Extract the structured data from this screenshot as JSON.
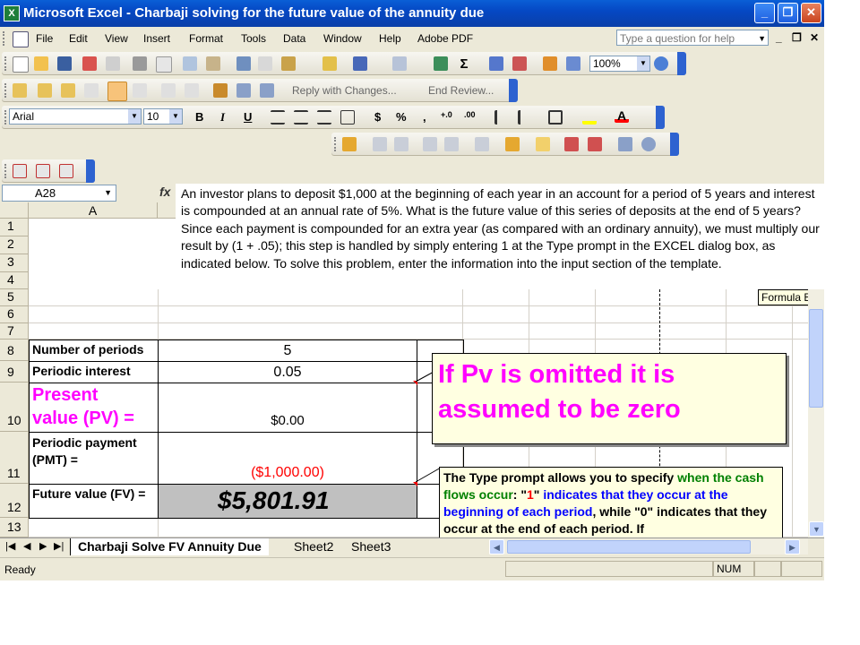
{
  "window": {
    "title": "Microsoft Excel - Charbaji solving  for the future value of the annuity due",
    "app_icon_glyph": "X",
    "minimize_glyph": "_",
    "restore_glyph": "❐",
    "close_glyph": "✕"
  },
  "menu": {
    "items": [
      "File",
      "Edit",
      "View",
      "Insert",
      "Format",
      "Tools",
      "Data",
      "Window",
      "Help",
      "Adobe PDF"
    ],
    "ask_placeholder": "Type a question for help",
    "doc_min": "_",
    "doc_restore": "❐",
    "doc_close": "✕"
  },
  "toolbars": {
    "zoom": "100%",
    "reviewing": {
      "reply_label": "Reply with Changes...",
      "end_review_label": "End Review..."
    },
    "font_name": "Arial",
    "font_size": "10",
    "bold": "B",
    "italic": "I",
    "underline": "U",
    "currency": "$",
    "percent": "%",
    "comma": ","
  },
  "formula_bar": {
    "name_box": "A28",
    "fx": "fx",
    "content": "An investor plans to deposit $1,000 at the beginning of each year in an account for a period of 5 years and interest is compounded at an annual rate of 5%. What is the future value of this series of deposits at the end of 5 years? Since each payment is compounded for an extra year (as compared with an ordinary annuity), we must multiply our result by (1 + .05); this step is handled by simply entering 1 at the Type prompt in the EXCEL dialog box, as indicated below. To solve this problem, enter the information into the input section of the template.",
    "tooltip": "Formula Bar"
  },
  "grid": {
    "col_a": "A",
    "rows": [
      "1",
      "2",
      "3",
      "4",
      "5",
      "6",
      "7",
      "8",
      "9",
      "10",
      "11",
      "12",
      "13"
    ],
    "cells": {
      "a8": "Number of periods",
      "b8": "5",
      "a9": "Periodic interest",
      "b9": "0.05",
      "a10_line1": "Present",
      "a10_line2": "value (PV) =",
      "b10": "$0.00",
      "a11_line1": "Periodic payment",
      "a11_line2": "(PMT) =",
      "b11": "($1,000.00)",
      "a12": "Future value (FV) =",
      "b12": "$5,801.91"
    }
  },
  "comments": {
    "pv": "If Pv is omitted it is assumed to be zero",
    "type": {
      "p1": "The Type prompt allows you to specify ",
      "p2": "when the cash flows occur",
      "p3": ": \"",
      "p4": "1",
      "p5": "\" ",
      "p6": "indicates that they occur at the beginning of each period",
      "p7": ", while \"0\" indicates that they occur at the end of each period. If"
    }
  },
  "sheets": {
    "nav": [
      "|◀",
      "◀",
      "▶",
      "▶|"
    ],
    "tabs": [
      "Charbaji  Solve FV  Annuity Due",
      "Sheet2",
      "Sheet3"
    ]
  },
  "status": {
    "text": "Ready",
    "num": "NUM"
  }
}
